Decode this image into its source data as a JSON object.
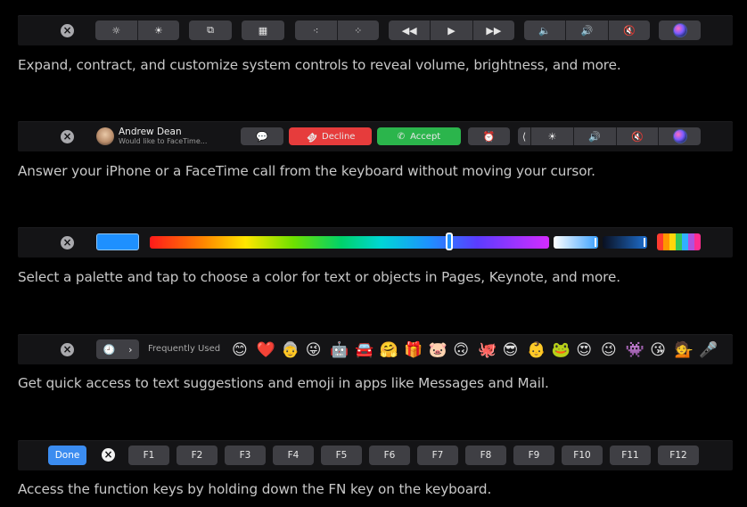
{
  "captions": {
    "c1": "Expand, contract, and customize system controls to reveal volume, brightness, and more.",
    "c2": "Answer your iPhone or a FaceTime call from the keyboard without moving your cursor.",
    "c3": "Select a palette and tap to choose a color for text or objects in Pages, Keynote, and more.",
    "c4": "Get quick access to text suggestions and emoji in apps like Messages and Mail.",
    "c5": "Access the function keys by holding down the FN key on the keyboard."
  },
  "bar1": {
    "close_glyph": "×",
    "brightness_down": "☼",
    "brightness_up": "☀",
    "mission_control": "⧉",
    "launchpad": "▦",
    "kbd_light_down": "⁖",
    "kbd_light_up": "⁘",
    "rewind": "◀◀",
    "play": "▶",
    "fast_forward": "▶▶",
    "volume_down": "🔈",
    "volume_up": "🔊",
    "mute": "🔇"
  },
  "bar2": {
    "close_glyph": "×",
    "caller_name": "Andrew Dean",
    "caller_sub": "Would like to FaceTime...",
    "message_glyph": "💬",
    "decline_glyph": "☎",
    "decline": "Decline",
    "accept_glyph": "✆",
    "accept": "Accept",
    "alarm_glyph": "⏰",
    "chevron": "⟨",
    "brightness": "☀",
    "volume": "🔊",
    "mute": "🔇"
  },
  "bar3": {
    "close_glyph": "×",
    "selected_color": "#1e90ff"
  },
  "bar4": {
    "close_glyph": "×",
    "clock_glyph": "🕘",
    "chevron": "›",
    "category": "Frequently Used",
    "emojis": [
      "😊",
      "❤️",
      "👵",
      "😜",
      "🤖",
      "🚘",
      "🤗",
      "🎁",
      "🐷",
      "🙃",
      "🐙",
      "😎",
      "👶",
      "🐸",
      "😍",
      "😉",
      "👾",
      "😘",
      "💁",
      "🎤"
    ]
  },
  "bar5": {
    "done": "Done",
    "close_glyph": "×",
    "keys": [
      "F1",
      "F2",
      "F3",
      "F4",
      "F5",
      "F6",
      "F7",
      "F8",
      "F9",
      "F10",
      "F11",
      "F12"
    ]
  },
  "colors": {
    "decline": "#e63c3c",
    "accept": "#2bb54c",
    "done": "#3b8cf0"
  }
}
